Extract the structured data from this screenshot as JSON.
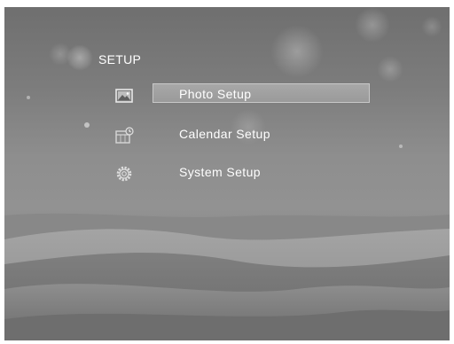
{
  "header": {
    "title": "SETUP",
    "icon": "gear-glow-icon"
  },
  "menu": {
    "items": [
      {
        "label": "Photo Setup",
        "icon": "photo-icon",
        "selected": true
      },
      {
        "label": "Calendar Setup",
        "icon": "calendar-icon",
        "selected": false
      },
      {
        "label": "System Setup",
        "icon": "gear-icon",
        "selected": false
      }
    ]
  },
  "colors": {
    "text": "#ffffff",
    "highlight": "#a3a3a3",
    "background": "#808080"
  }
}
